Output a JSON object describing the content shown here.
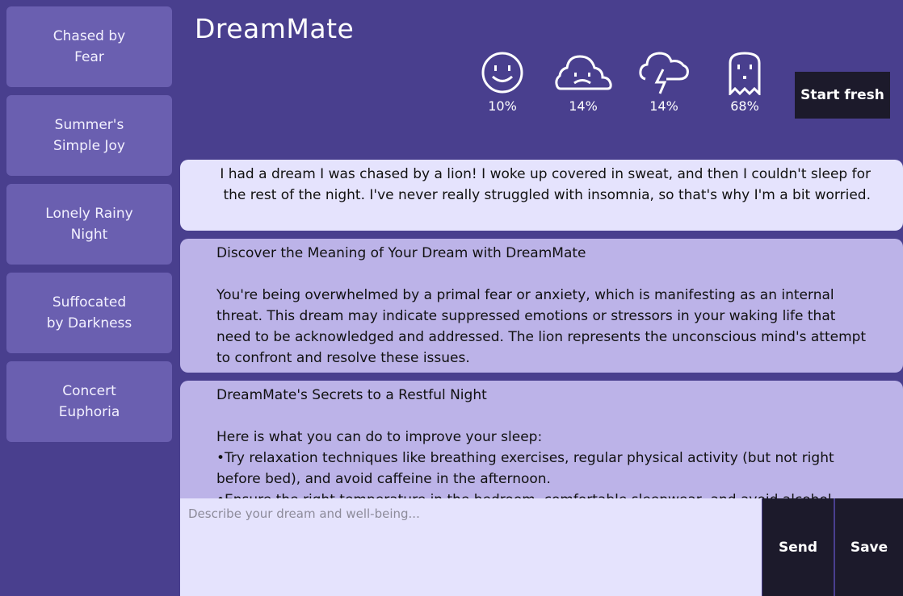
{
  "app": {
    "title": "DreamMate"
  },
  "sidebar": {
    "items": [
      {
        "label": "Chased by Fear"
      },
      {
        "label": "Summer's Simple Joy"
      },
      {
        "label": "Lonely Rainy Night"
      },
      {
        "label": "Suffocated by Darkness"
      },
      {
        "label": "Concert Euphoria"
      }
    ]
  },
  "moods": [
    {
      "icon": "happy-face-icon",
      "value": "10%"
    },
    {
      "icon": "sad-cloud-icon",
      "value": "14%"
    },
    {
      "icon": "storm-cloud-icon",
      "value": "14%"
    },
    {
      "icon": "ghost-icon",
      "value": "68%"
    }
  ],
  "header": {
    "start_label": "Start fresh"
  },
  "chat": {
    "user_message": "I had a dream I was chased by a lion! I woke up covered in sweat, and then I couldn't sleep for the rest of the night. I've never really struggled with insomnia, so that's why I'm a bit worried.",
    "reply1": "Discover the Meaning of Your Dream with DreamMate\n\nYou're being overwhelmed by a primal fear or anxiety, which is manifesting as an internal threat. This dream may indicate suppressed emotions or stressors in your waking life that need to be acknowledged and addressed. The lion represents the unconscious mind's attempt to confront and resolve these issues.",
    "reply2": "DreamMate's Secrets to a Restful Night\n\nHere is what you can do to improve your sleep:\n•Try relaxation techniques like breathing exercises, regular physical activity (but not right before bed), and avoid caffeine in the afternoon.\n•Ensure the right temperature in the bedroom, comfortable sleepwear, and avoid alcohol"
  },
  "input": {
    "placeholder": "Describe your dream and well-being..."
  },
  "actions": {
    "send_label": "Send",
    "save_label": "Save"
  },
  "colors": {
    "background": "#493f8e",
    "card": "#6a5fb0",
    "user_bubble": "#e5e3fd",
    "bot_bubble": "#bcb3e8",
    "button": "#1c1a2b"
  }
}
